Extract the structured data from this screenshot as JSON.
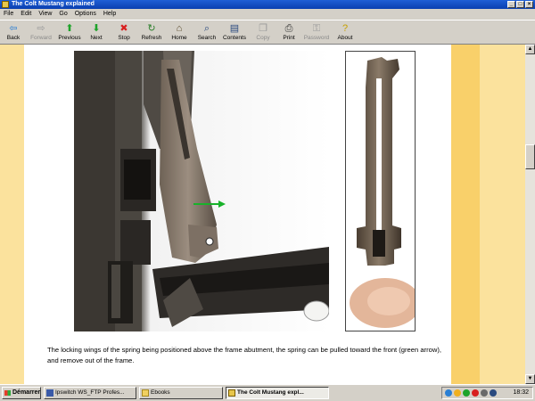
{
  "window": {
    "title": "The Colt Mustang explained",
    "minimize": "_",
    "maximize": "□",
    "close": "×"
  },
  "menu": [
    "File",
    "Edit",
    "View",
    "Go",
    "Options",
    "Help"
  ],
  "toolbar": [
    {
      "label": "Back",
      "icon": "back-arrow-icon",
      "glyph": "⇦",
      "color": "#2a7fd4",
      "enabled": true
    },
    {
      "label": "Forward",
      "icon": "forward-arrow-icon",
      "glyph": "⇨",
      "color": "#9a9a9a",
      "enabled": false
    },
    {
      "label": "Previous",
      "icon": "up-arrow-icon",
      "glyph": "⬆",
      "color": "#1ea32a",
      "enabled": true
    },
    {
      "label": "Next",
      "icon": "down-arrow-icon",
      "glyph": "⬇",
      "color": "#1ea32a",
      "enabled": true
    },
    {
      "label": "Stop",
      "icon": "stop-icon",
      "glyph": "✖",
      "color": "#d81f1f",
      "enabled": true
    },
    {
      "label": "Refresh",
      "icon": "refresh-icon",
      "glyph": "↻",
      "color": "#2a7f2a",
      "enabled": true
    },
    {
      "label": "Home",
      "icon": "home-icon",
      "glyph": "⌂",
      "color": "#5a4a2a",
      "enabled": true
    },
    {
      "label": "Search",
      "icon": "search-icon",
      "glyph": "⌕",
      "color": "#2a4a7f",
      "enabled": true
    },
    {
      "label": "Contents",
      "icon": "contents-icon",
      "glyph": "▤",
      "color": "#2a4a7f",
      "enabled": true
    },
    {
      "label": "Copy",
      "icon": "copy-icon",
      "glyph": "❐",
      "color": "#9a9a9a",
      "enabled": false
    },
    {
      "label": "Print",
      "icon": "print-icon",
      "glyph": "⎙",
      "color": "#333333",
      "enabled": true
    },
    {
      "label": "Password",
      "icon": "key-icon",
      "glyph": "⚿",
      "color": "#9a9a9a",
      "enabled": false
    },
    {
      "label": "About",
      "icon": "about-icon",
      "glyph": "?",
      "color": "#c7a100",
      "enabled": true
    }
  ],
  "content": {
    "caption": "The locking wings of the spring being positioned above the frame abutment, the spring can be pulled toward the front (green arrow), and remove out of the frame.",
    "arrow_color": "#18b22a",
    "left_bg": "#fbe29d",
    "right_bg": "#f9d06a"
  },
  "scrollbar": {
    "up": "▲",
    "down": "▼"
  },
  "taskbar": {
    "start": "Démarrer",
    "tasks": [
      {
        "label": "Ipswitch WS_FTP Profes...",
        "active": false
      },
      {
        "label": "Ebooks",
        "active": false
      },
      {
        "label": "The Colt Mustang expl...",
        "active": true
      }
    ],
    "clock": "18:32"
  }
}
